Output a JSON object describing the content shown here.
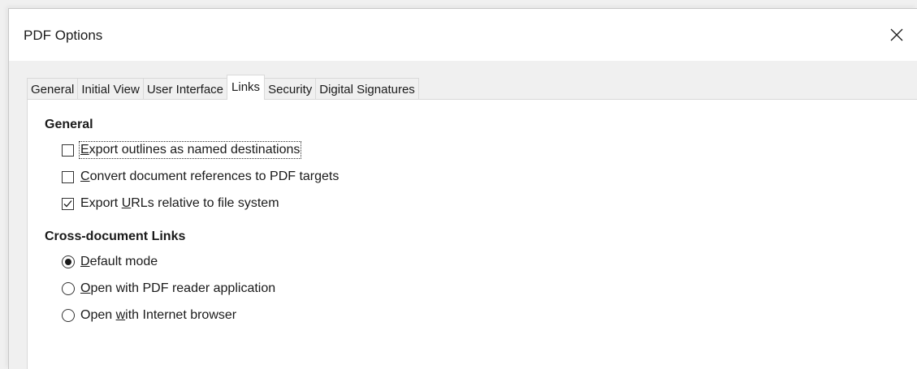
{
  "window": {
    "title": "PDF Options"
  },
  "icons": {
    "close": "close-icon",
    "check": "checkmark-icon"
  },
  "tabs": [
    {
      "label": "General",
      "active": false
    },
    {
      "label": "Initial View",
      "active": false
    },
    {
      "label": "User Interface",
      "active": false
    },
    {
      "label": "Links",
      "active": true
    },
    {
      "label": "Security",
      "active": false
    },
    {
      "label": "Digital Signatures",
      "active": false
    }
  ],
  "general": {
    "heading": "General",
    "options": [
      {
        "pre": "",
        "key": "E",
        "post": "xport outlines as named destinations",
        "checked": false,
        "focused": true
      },
      {
        "pre": "",
        "key": "C",
        "post": "onvert document references to PDF targets",
        "checked": false,
        "focused": false
      },
      {
        "pre": "Export ",
        "key": "U",
        "post": "RLs relative to file system",
        "checked": true,
        "focused": false
      }
    ]
  },
  "cross": {
    "heading": "Cross-document Links",
    "options": [
      {
        "pre": "",
        "key": "D",
        "post": "efault mode",
        "selected": true
      },
      {
        "pre": "",
        "key": "O",
        "post": "pen with PDF reader application",
        "selected": false
      },
      {
        "pre": "Open ",
        "key": "w",
        "post": "ith Internet browser",
        "selected": false
      }
    ]
  }
}
